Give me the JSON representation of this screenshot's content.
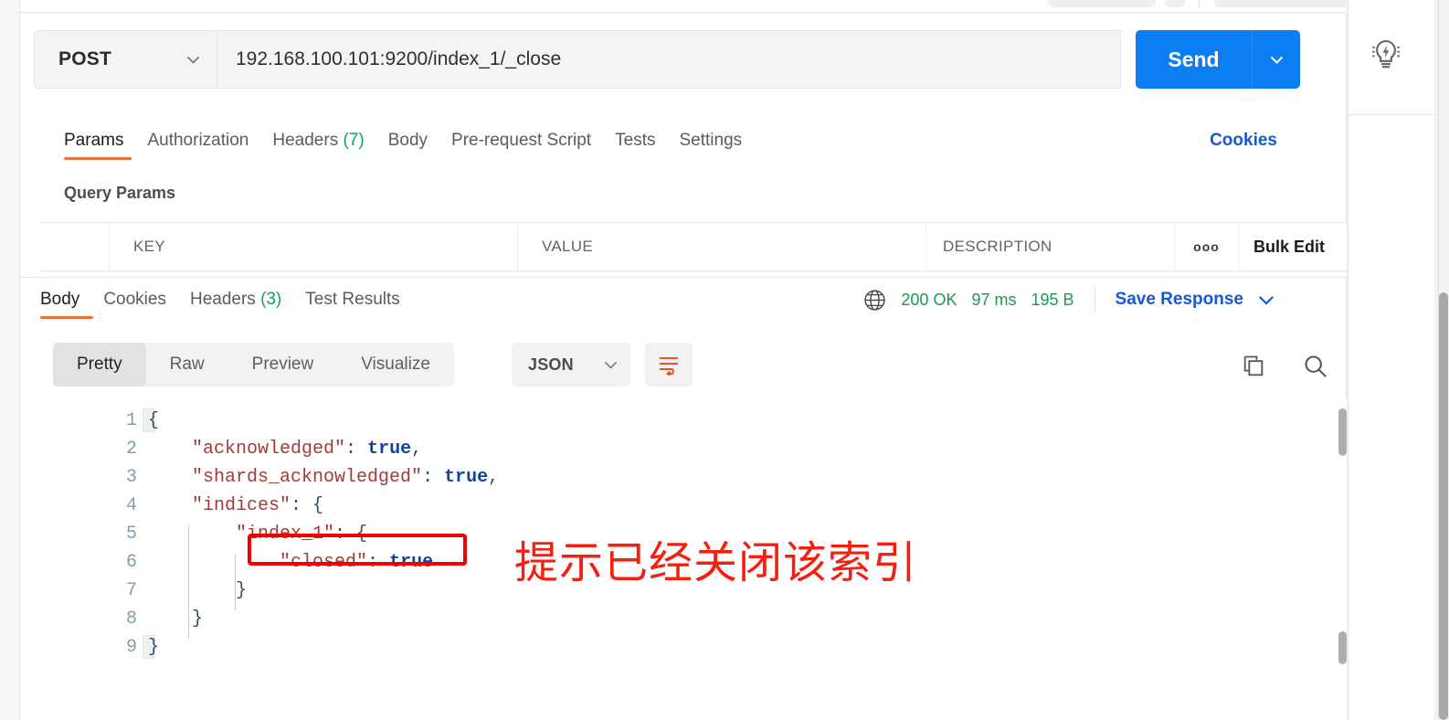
{
  "request": {
    "method": "POST",
    "url": "192.168.100.101:9200/index_1/_close",
    "send_label": "Send",
    "tabs": [
      {
        "label": "Params",
        "count": null,
        "active": true
      },
      {
        "label": "Authorization",
        "count": null,
        "active": false
      },
      {
        "label": "Headers",
        "count": "(7)",
        "active": false
      },
      {
        "label": "Body",
        "count": null,
        "active": false
      },
      {
        "label": "Pre-request Script",
        "count": null,
        "active": false
      },
      {
        "label": "Tests",
        "count": null,
        "active": false
      },
      {
        "label": "Settings",
        "count": null,
        "active": false
      }
    ],
    "cookies_link": "Cookies",
    "query_params_title": "Query Params",
    "table": {
      "columns": [
        "KEY",
        "VALUE",
        "DESCRIPTION"
      ],
      "options_label": "ooo",
      "bulk_edit_label": "Bulk Edit",
      "rows": []
    }
  },
  "response": {
    "tabs": [
      {
        "label": "Body",
        "count": null,
        "active": true
      },
      {
        "label": "Cookies",
        "count": null,
        "active": false
      },
      {
        "label": "Headers",
        "count": "(3)",
        "active": false
      },
      {
        "label": "Test Results",
        "count": null,
        "active": false
      }
    ],
    "status": "200 OK",
    "time": "97 ms",
    "size": "195 B",
    "save_response_label": "Save Response",
    "view_modes": [
      {
        "label": "Pretty",
        "active": true
      },
      {
        "label": "Raw",
        "active": false
      },
      {
        "label": "Preview",
        "active": false
      },
      {
        "label": "Visualize",
        "active": false
      }
    ],
    "format": "JSON",
    "line_numbers": [
      "1",
      "2",
      "3",
      "4",
      "5",
      "6",
      "7",
      "8",
      "9"
    ],
    "body_lines": [
      {
        "indent": 0,
        "segments": [
          {
            "t": "{",
            "c": "punc"
          }
        ]
      },
      {
        "indent": 1,
        "segments": [
          {
            "t": "\"acknowledged\"",
            "c": "key"
          },
          {
            "t": ": ",
            "c": "punc"
          },
          {
            "t": "true",
            "c": "bool"
          },
          {
            "t": ",",
            "c": "punc"
          }
        ]
      },
      {
        "indent": 1,
        "segments": [
          {
            "t": "\"shards_acknowledged\"",
            "c": "key"
          },
          {
            "t": ": ",
            "c": "punc"
          },
          {
            "t": "true",
            "c": "bool"
          },
          {
            "t": ",",
            "c": "punc"
          }
        ]
      },
      {
        "indent": 1,
        "segments": [
          {
            "t": "\"indices\"",
            "c": "key"
          },
          {
            "t": ": {",
            "c": "punc"
          }
        ]
      },
      {
        "indent": 2,
        "segments": [
          {
            "t": "\"index_1\"",
            "c": "key"
          },
          {
            "t": ": {",
            "c": "punc"
          }
        ]
      },
      {
        "indent": 3,
        "segments": [
          {
            "t": "\"closed\"",
            "c": "key"
          },
          {
            "t": ": ",
            "c": "punc"
          },
          {
            "t": "true",
            "c": "bool"
          }
        ]
      },
      {
        "indent": 2,
        "segments": [
          {
            "t": "}",
            "c": "punc"
          }
        ]
      },
      {
        "indent": 1,
        "segments": [
          {
            "t": "}",
            "c": "punc"
          }
        ]
      },
      {
        "indent": 0,
        "segments": [
          {
            "t": "}",
            "c": "punc"
          }
        ]
      }
    ]
  },
  "annotation": {
    "text": "提示已经关闭该索引",
    "color": "#f41f0f",
    "highlighted_code": "\"closed\": true"
  },
  "colors": {
    "accent_blue": "#0b7ef4",
    "tab_underline": "#f26b3a",
    "status_green": "#1a9b53",
    "link_blue": "#1559d6",
    "annotation_red": "#f20000"
  }
}
